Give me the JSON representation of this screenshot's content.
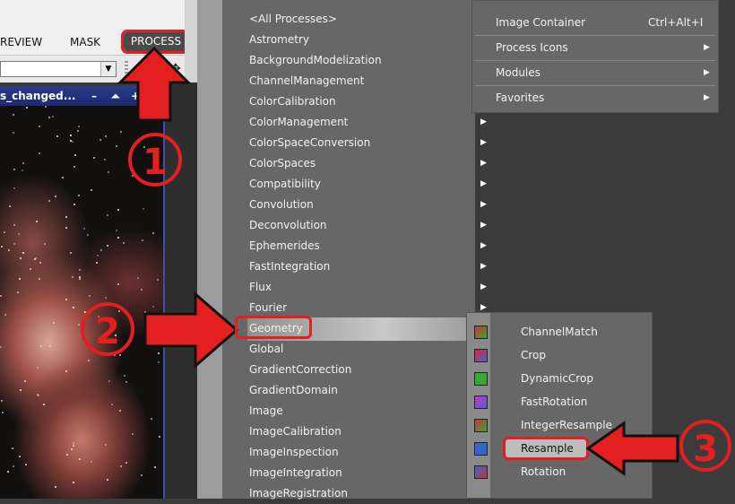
{
  "app": {
    "menubar": {
      "preview_partial": "REVIEW",
      "mask": "MASK",
      "process": "PROCESS"
    },
    "view_title": "s_changed..."
  },
  "process_menu": {
    "items": [
      "<All Processes>",
      "Astrometry",
      "BackgroundModelization",
      "ChannelManagement",
      "ColorCalibration",
      "ColorManagement",
      "ColorSpaceConversion",
      "ColorSpaces",
      "Compatibility",
      "Convolution",
      "Deconvolution",
      "Ephemerides",
      "FastIntegration",
      "Flux",
      "Fourier",
      "Geometry",
      "Global",
      "GradientCorrection",
      "GradientDomain",
      "Image",
      "ImageCalibration",
      "ImageInspection",
      "ImageIntegration",
      "ImageRegistration"
    ],
    "highlighted": "Geometry"
  },
  "process_submenu_top": {
    "items": [
      {
        "label": "Image Container",
        "shortcut": "Ctrl+Alt+I"
      },
      {
        "label": "Process Icons",
        "shortcut": ""
      },
      {
        "label": "Modules",
        "shortcut": ""
      },
      {
        "label": "Favorites",
        "shortcut": ""
      }
    ]
  },
  "geometry_submenu": {
    "items": [
      "ChannelMatch",
      "Crop",
      "DynamicCrop",
      "FastRotation",
      "IntegerResample",
      "Resample",
      "Rotation"
    ],
    "highlighted": "Resample"
  },
  "annotations": {
    "step1": "1",
    "step2": "2",
    "step3": "3"
  },
  "colors": {
    "menu_bg": "#676767",
    "annotation_red": "#e41f1f",
    "view_titlebar": "#2c3c8c"
  },
  "icons": {
    "all_processes": "color-grid-icon",
    "geometry_items": [
      "channelmatch-icon",
      "crop-icon",
      "dynamiccrop-icon",
      "fastrotation-icon",
      "integerresample-icon",
      "resample-icon",
      "rotation-icon"
    ]
  }
}
